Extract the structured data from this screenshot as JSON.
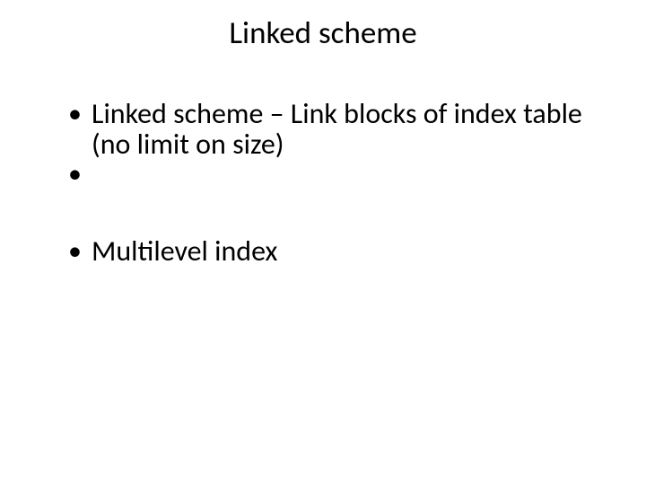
{
  "slide": {
    "title": "Linked scheme",
    "bullets": [
      "Linked scheme – Link blocks of index table (no limit on size)",
      "Multilevel index"
    ]
  }
}
